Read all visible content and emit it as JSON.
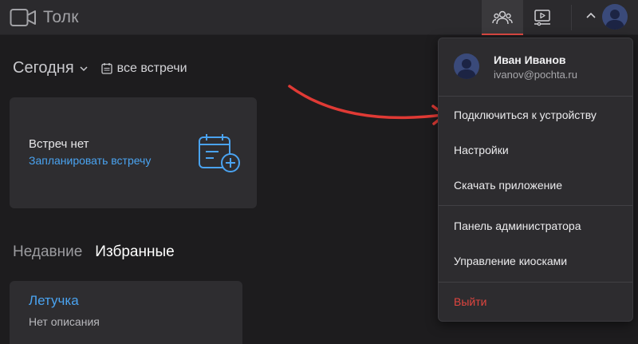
{
  "app": {
    "name": "Толк"
  },
  "header": {
    "buttons": [
      {
        "icon": "people-icon",
        "active": true
      },
      {
        "icon": "screen-device-icon",
        "active": false
      }
    ],
    "accent_color": "#e04a44"
  },
  "main": {
    "today_label": "Сегодня",
    "all_meetings_label": "все встречи",
    "empty_card": {
      "title": "Встреч нет",
      "link": "Запланировать встречу"
    },
    "tabs": [
      {
        "label": "Недавние",
        "active": false
      },
      {
        "label": "Избранные",
        "active": true
      }
    ],
    "meeting": {
      "title": "Летучка",
      "description": "Нет описания"
    }
  },
  "menu": {
    "user_name": "Иван Иванов",
    "user_email": "ivanov@pochta.ru",
    "items": [
      {
        "label": "Подключиться к устройству"
      },
      {
        "label": "Настройки"
      },
      {
        "label": "Скачать приложение"
      },
      {
        "label": "Панель администратора"
      },
      {
        "label": "Управление киосками"
      },
      {
        "label": "Выйти",
        "danger": true
      }
    ]
  },
  "colors": {
    "link_blue": "#4aa3f0",
    "danger_red": "#e0453f",
    "arrow_red": "#e03a35"
  }
}
